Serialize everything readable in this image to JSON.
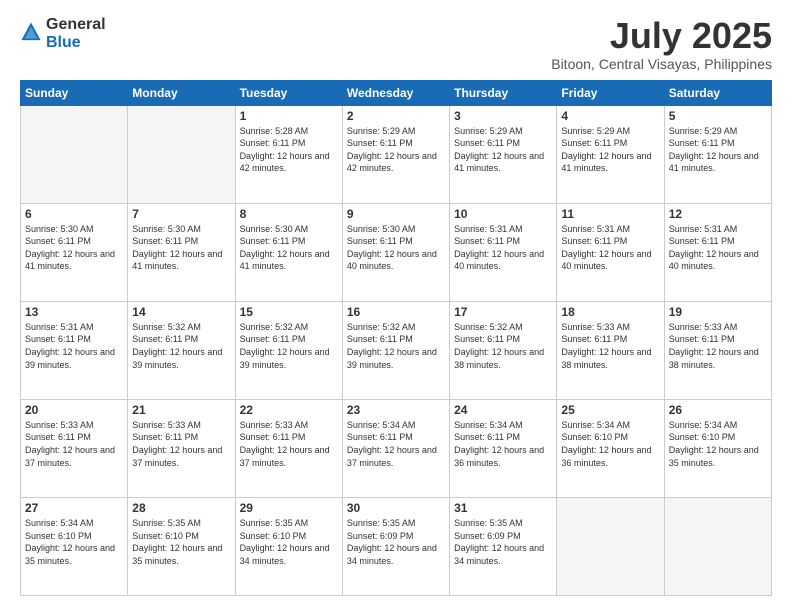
{
  "header": {
    "logo_general": "General",
    "logo_blue": "Blue",
    "title": "July 2025",
    "subtitle": "Bitoon, Central Visayas, Philippines"
  },
  "weekdays": [
    "Sunday",
    "Monday",
    "Tuesday",
    "Wednesday",
    "Thursday",
    "Friday",
    "Saturday"
  ],
  "weeks": [
    [
      {
        "day": "",
        "info": ""
      },
      {
        "day": "",
        "info": ""
      },
      {
        "day": "1",
        "info": "Sunrise: 5:28 AM\nSunset: 6:11 PM\nDaylight: 12 hours and 42 minutes."
      },
      {
        "day": "2",
        "info": "Sunrise: 5:29 AM\nSunset: 6:11 PM\nDaylight: 12 hours and 42 minutes."
      },
      {
        "day": "3",
        "info": "Sunrise: 5:29 AM\nSunset: 6:11 PM\nDaylight: 12 hours and 41 minutes."
      },
      {
        "day": "4",
        "info": "Sunrise: 5:29 AM\nSunset: 6:11 PM\nDaylight: 12 hours and 41 minutes."
      },
      {
        "day": "5",
        "info": "Sunrise: 5:29 AM\nSunset: 6:11 PM\nDaylight: 12 hours and 41 minutes."
      }
    ],
    [
      {
        "day": "6",
        "info": "Sunrise: 5:30 AM\nSunset: 6:11 PM\nDaylight: 12 hours and 41 minutes."
      },
      {
        "day": "7",
        "info": "Sunrise: 5:30 AM\nSunset: 6:11 PM\nDaylight: 12 hours and 41 minutes."
      },
      {
        "day": "8",
        "info": "Sunrise: 5:30 AM\nSunset: 6:11 PM\nDaylight: 12 hours and 41 minutes."
      },
      {
        "day": "9",
        "info": "Sunrise: 5:30 AM\nSunset: 6:11 PM\nDaylight: 12 hours and 40 minutes."
      },
      {
        "day": "10",
        "info": "Sunrise: 5:31 AM\nSunset: 6:11 PM\nDaylight: 12 hours and 40 minutes."
      },
      {
        "day": "11",
        "info": "Sunrise: 5:31 AM\nSunset: 6:11 PM\nDaylight: 12 hours and 40 minutes."
      },
      {
        "day": "12",
        "info": "Sunrise: 5:31 AM\nSunset: 6:11 PM\nDaylight: 12 hours and 40 minutes."
      }
    ],
    [
      {
        "day": "13",
        "info": "Sunrise: 5:31 AM\nSunset: 6:11 PM\nDaylight: 12 hours and 39 minutes."
      },
      {
        "day": "14",
        "info": "Sunrise: 5:32 AM\nSunset: 6:11 PM\nDaylight: 12 hours and 39 minutes."
      },
      {
        "day": "15",
        "info": "Sunrise: 5:32 AM\nSunset: 6:11 PM\nDaylight: 12 hours and 39 minutes."
      },
      {
        "day": "16",
        "info": "Sunrise: 5:32 AM\nSunset: 6:11 PM\nDaylight: 12 hours and 39 minutes."
      },
      {
        "day": "17",
        "info": "Sunrise: 5:32 AM\nSunset: 6:11 PM\nDaylight: 12 hours and 38 minutes."
      },
      {
        "day": "18",
        "info": "Sunrise: 5:33 AM\nSunset: 6:11 PM\nDaylight: 12 hours and 38 minutes."
      },
      {
        "day": "19",
        "info": "Sunrise: 5:33 AM\nSunset: 6:11 PM\nDaylight: 12 hours and 38 minutes."
      }
    ],
    [
      {
        "day": "20",
        "info": "Sunrise: 5:33 AM\nSunset: 6:11 PM\nDaylight: 12 hours and 37 minutes."
      },
      {
        "day": "21",
        "info": "Sunrise: 5:33 AM\nSunset: 6:11 PM\nDaylight: 12 hours and 37 minutes."
      },
      {
        "day": "22",
        "info": "Sunrise: 5:33 AM\nSunset: 6:11 PM\nDaylight: 12 hours and 37 minutes."
      },
      {
        "day": "23",
        "info": "Sunrise: 5:34 AM\nSunset: 6:11 PM\nDaylight: 12 hours and 37 minutes."
      },
      {
        "day": "24",
        "info": "Sunrise: 5:34 AM\nSunset: 6:11 PM\nDaylight: 12 hours and 36 minutes."
      },
      {
        "day": "25",
        "info": "Sunrise: 5:34 AM\nSunset: 6:10 PM\nDaylight: 12 hours and 36 minutes."
      },
      {
        "day": "26",
        "info": "Sunrise: 5:34 AM\nSunset: 6:10 PM\nDaylight: 12 hours and 35 minutes."
      }
    ],
    [
      {
        "day": "27",
        "info": "Sunrise: 5:34 AM\nSunset: 6:10 PM\nDaylight: 12 hours and 35 minutes."
      },
      {
        "day": "28",
        "info": "Sunrise: 5:35 AM\nSunset: 6:10 PM\nDaylight: 12 hours and 35 minutes."
      },
      {
        "day": "29",
        "info": "Sunrise: 5:35 AM\nSunset: 6:10 PM\nDaylight: 12 hours and 34 minutes."
      },
      {
        "day": "30",
        "info": "Sunrise: 5:35 AM\nSunset: 6:09 PM\nDaylight: 12 hours and 34 minutes."
      },
      {
        "day": "31",
        "info": "Sunrise: 5:35 AM\nSunset: 6:09 PM\nDaylight: 12 hours and 34 minutes."
      },
      {
        "day": "",
        "info": ""
      },
      {
        "day": "",
        "info": ""
      }
    ]
  ]
}
